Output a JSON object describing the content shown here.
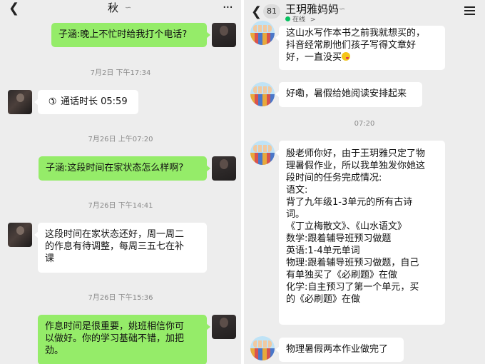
{
  "left": {
    "header": {
      "title": "秋",
      "mute_icon": "mute-icon",
      "more_icon": "more-dots-icon",
      "back_icon": "chevron-left-icon"
    },
    "messages": [
      {
        "type": "text",
        "side": "right",
        "text": "子涵:晚上不忙时给我打个电话?"
      },
      {
        "type": "timestamp",
        "text": "7月2日 下午17:34"
      },
      {
        "type": "call",
        "side": "left",
        "icon": "phone-hangup-icon",
        "text": "通话时长 05:59"
      },
      {
        "type": "timestamp",
        "text": "7月26日 上午07:20"
      },
      {
        "type": "text",
        "side": "right",
        "text": "子涵:这段时间在家状态怎么样啊?"
      },
      {
        "type": "timestamp",
        "text": "7月26日 下午14:41"
      },
      {
        "type": "text",
        "side": "left",
        "lines": [
          "这段时间在家状态还好，周一周二",
          "的作息有待调整，每周三五七在补",
          "课"
        ]
      },
      {
        "type": "timestamp",
        "text": "7月26日 下午15:36"
      },
      {
        "type": "text",
        "side": "right",
        "lines": [
          "作息时间是很重要，姚班相信你可",
          "以做好。你的学习基础不错，加把",
          "劲。"
        ]
      }
    ]
  },
  "right": {
    "header": {
      "unread_count": "81",
      "title": "王玥雅妈妈",
      "status": "在线",
      "status_chevron": ">",
      "back_icon": "chevron-left-icon",
      "menu_icon": "menu-icon",
      "status_color": "#07c160"
    },
    "messages": [
      {
        "type": "text",
        "side": "left",
        "lines": [
          "这山水写作本书之前我就想买的，",
          "抖音经常刷他们孩子写得文章好",
          "好，一直没买"
        ],
        "trailing_emoji": "grin-tongue-emoji"
      },
      {
        "type": "text",
        "side": "left",
        "text": "好嘞，暑假给她阅读安排起来"
      },
      {
        "type": "timestamp",
        "text": "07:20"
      },
      {
        "type": "text",
        "side": "left",
        "lines": [
          "殷老师你好，由于王玥雅只定了物",
          "理暑假作业，所以我单独发你她这",
          "段时间的任务完成情况:",
          "语文:",
          "背了九年级1-3单元的所有古诗",
          "词。",
          "《丁立梅散文》、《山水语文》",
          "数学:跟着辅导班预习做题",
          "英语:1-4单元单词",
          "物理:跟着辅导班预习做题，自己",
          "有单独买了《必刷题》在做",
          "化学:自主预习了第一个单元，买",
          "的《必刷题》在做"
        ]
      },
      {
        "type": "text",
        "side": "left",
        "text": "物理暑假两本作业做完了"
      }
    ]
  },
  "colors": {
    "chat_bg": "#ededed",
    "bubble_green": "#95ec69",
    "bubble_white": "#ffffff",
    "timestamp_text": "#8a8a8a"
  }
}
